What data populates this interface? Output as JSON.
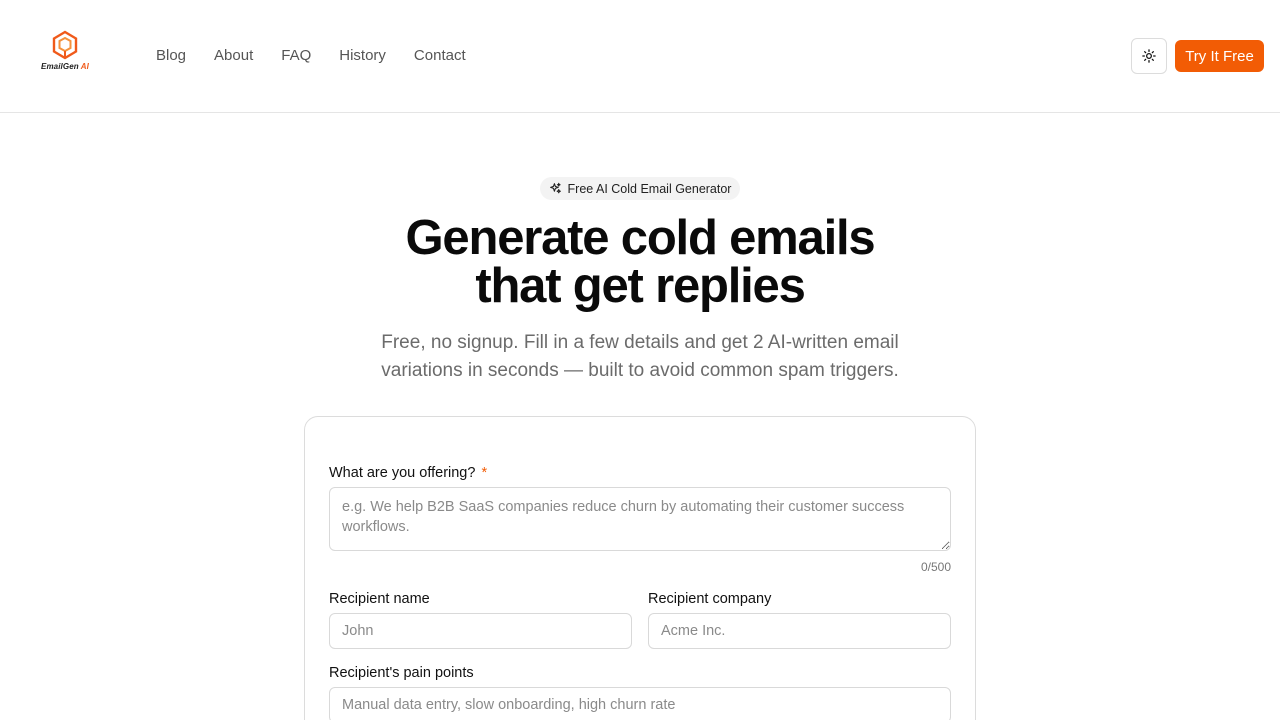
{
  "brand": {
    "name": "EmailGen",
    "suffix": "AI",
    "accent": "#f25c05"
  },
  "nav": {
    "items": [
      "Blog",
      "About",
      "FAQ",
      "History",
      "Contact"
    ]
  },
  "header": {
    "theme_icon": "sun-icon",
    "cta_label": "Try It Free"
  },
  "hero": {
    "badge": "Free AI Cold Email Generator",
    "badge_icon": "sparkles-icon",
    "title_line1": "Generate cold emails",
    "title_line2": "that get replies",
    "subtitle_line1": "Free, no signup. Fill in a few details and get 2 AI-written email",
    "subtitle_line2": "variations in seconds — built to avoid common spam triggers."
  },
  "form": {
    "offering": {
      "label": "What are you offering?",
      "required_mark": "*",
      "placeholder": "e.g. We help B2B SaaS companies reduce churn by automating their customer success workflows.",
      "counter": "0/500"
    },
    "recipient_name": {
      "label": "Recipient name",
      "placeholder": "John"
    },
    "recipient_company": {
      "label": "Recipient company",
      "placeholder": "Acme Inc."
    },
    "pain_points": {
      "label": "Recipient's pain points",
      "placeholder": "Manual data entry, slow onboarding, high churn rate"
    }
  }
}
